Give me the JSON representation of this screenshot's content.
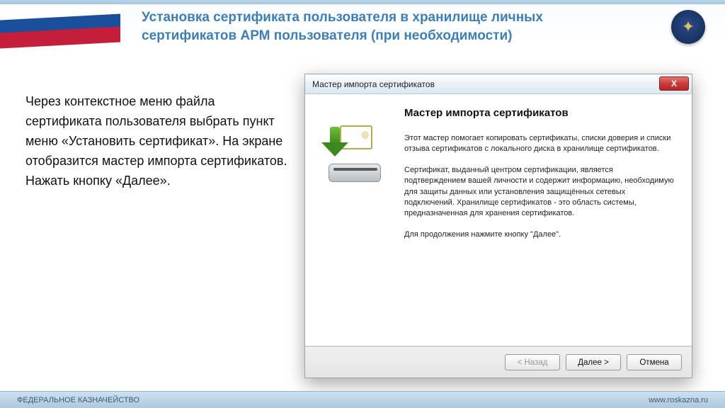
{
  "slide": {
    "title": "Установка сертификата пользователя в хранилище личных сертификатов АРМ пользователя (при необходимости)",
    "body": "Через контекстное меню файла сертификата пользователя выбрать пункт меню «Установить сертификат». На экране отобразится мастер импорта сертификатов. Нажать кнопку «Далее»."
  },
  "wizard": {
    "window_title": "Мастер импорта сертификатов",
    "heading": "Мастер импорта сертификатов",
    "para1": "Этот мастер помогает копировать сертификаты, списки доверия и списки отзыва сертификатов с локального диска в хранилище сертификатов.",
    "para2": "Сертификат, выданный центром сертификации, является подтверждением вашей личности и содержит информацию, необходимую для защиты данных или установления защищённых сетевых подключений. Хранилище сертификатов - это область системы, предназначенная для хранения сертификатов.",
    "para3": "Для продолжения нажмите кнопку \"Далее\".",
    "buttons": {
      "back": "< Назад",
      "next": "Далее >",
      "cancel": "Отмена"
    },
    "close_label": "X"
  },
  "footer": {
    "left": "ФЕДЕРАЛЬНОЕ КАЗНАЧЕЙСТВО",
    "right": "www.roskazna.ru"
  }
}
